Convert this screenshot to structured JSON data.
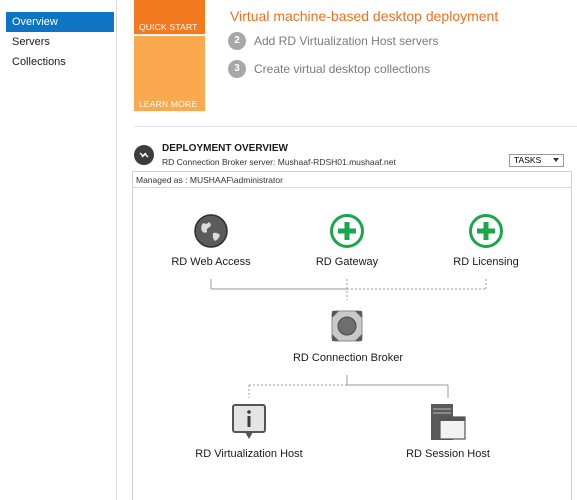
{
  "nav": {
    "items": [
      {
        "label": "Overview",
        "active": true
      },
      {
        "label": "Servers",
        "active": false
      },
      {
        "label": "Collections",
        "active": false
      }
    ]
  },
  "quick_start": {
    "tile_labels": [
      "QUICK START",
      "LEARN MORE"
    ],
    "title": "Virtual machine-based desktop deployment",
    "steps": [
      {
        "number": "2",
        "text": "Add RD Virtualization Host servers"
      },
      {
        "number": "3",
        "text": "Create virtual desktop collections"
      }
    ]
  },
  "deployment": {
    "title": "DEPLOYMENT OVERVIEW",
    "subtitle": "RD Connection Broker server: Mushaaf-RDSH01.mushaaf.net",
    "tasks_label": "TASKS",
    "managed_as": "Managed as : MUSHAAF\\administrator",
    "roles": {
      "web_access": "RD Web Access",
      "gateway": "RD Gateway",
      "licensing": "RD Licensing",
      "connection_broker": "RD Connection Broker",
      "virtualization_host": "RD Virtualization Host",
      "session_host": "RD Session Host"
    }
  },
  "colors": {
    "nav_active": "#0e75c4",
    "quick_start_tile": "#f47a20",
    "learn_more_tile": "#fba94f",
    "title_orange": "#f26f1d",
    "add_icon_green": "#1aa64a"
  }
}
